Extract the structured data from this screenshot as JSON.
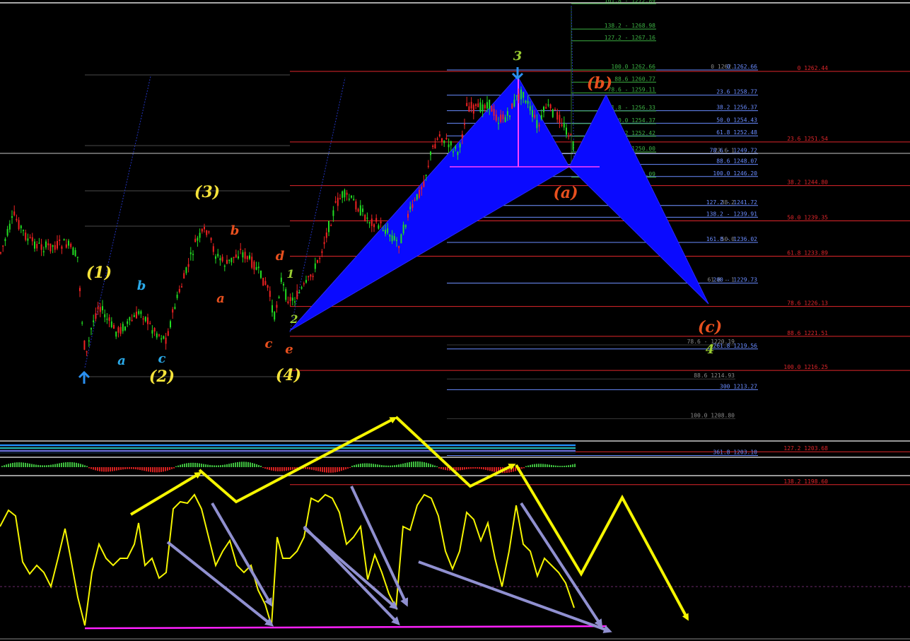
{
  "chart_data": {
    "type": "line",
    "price_axis_labels": [],
    "fib_red": [
      {
        "label": "0 1262.44",
        "price": 1262.44
      },
      {
        "label": "23.6 1251.54",
        "price": 1251.54
      },
      {
        "label": "38.2 1244.80",
        "price": 1244.8
      },
      {
        "label": "50.0 1239.35",
        "price": 1239.35
      },
      {
        "label": "61.8 1233.89",
        "price": 1233.89
      },
      {
        "label": "78.6 1226.13",
        "price": 1226.13
      },
      {
        "label": "88.6 1221.51",
        "price": 1221.51
      },
      {
        "label": "100.0 1216.25",
        "price": 1216.25
      },
      {
        "label": "127.2 1203.68",
        "price": 1203.68
      },
      {
        "label": "138.2 1198.60",
        "price": 1198.6
      }
    ],
    "fib_green": [
      {
        "label": "161.8 - 1272.89",
        "price": 1272.89
      },
      {
        "label": "138.2 - 1268.98",
        "price": 1268.98
      },
      {
        "label": "127.2 - 1267.16",
        "price": 1267.16
      },
      {
        "label": "100.0 1262.66",
        "price": 1262.66
      },
      {
        "label": "88.6 1260.77",
        "price": 1260.77
      },
      {
        "label": "78.6 - 1259.11",
        "price": 1259.11
      },
      {
        "label": "61.8 - 1256.33",
        "price": 1256.33
      },
      {
        "label": "50.0 1254.37",
        "price": 1254.37
      },
      {
        "label": "38.2 1252.42",
        "price": 1252.42
      },
      {
        "label": "23.6 1250.00",
        "price": 1250.0
      },
      {
        "label": "0 1246.09",
        "price": 1246.09
      }
    ],
    "fib_blue": [
      {
        "label": "0 1262.66",
        "price": 1262.66
      },
      {
        "label": "23.6 1258.77",
        "price": 1258.77
      },
      {
        "label": "38.2 1256.37",
        "price": 1256.37
      },
      {
        "label": "50.0 1254.43",
        "price": 1254.43
      },
      {
        "label": "61.8 1252.48",
        "price": 1252.48
      },
      {
        "label": "78.6 - 1249.72",
        "price": 1249.72
      },
      {
        "label": "88.6 1248.07",
        "price": 1248.07
      },
      {
        "label": "100.0 1246.20",
        "price": 1246.2
      },
      {
        "label": "127.2 - 1241.72",
        "price": 1241.72
      },
      {
        "label": "138.2 - 1239.91",
        "price": 1239.91
      },
      {
        "label": "161.8 - 1236.02",
        "price": 1236.02
      },
      {
        "label": "200 - 1229.73",
        "price": 1229.73
      },
      {
        "label": "261.8 1219.56",
        "price": 1219.56
      },
      {
        "label": "300 1213.27",
        "price": 1213.27
      },
      {
        "label": "361.8 1203.10",
        "price": 1203.1
      }
    ],
    "fib_gray": [
      {
        "label": "0 1262.",
        "price": 1262.66
      },
      {
        "label": "23.6 1",
        "price": 1249.72
      },
      {
        "label": "38.2",
        "price": 1241.72
      },
      {
        "label": "50.0",
        "price": 1236.02
      },
      {
        "label": "61.8 - 1",
        "price": 1229.73
      },
      {
        "label": "78.6 - 1220.19",
        "price": 1220.19
      },
      {
        "label": "88.6 1214.93",
        "price": 1214.93
      },
      {
        "label": "100.0 1208.80",
        "price": 1208.8
      }
    ],
    "wave_labels": [
      {
        "text": "(1)",
        "color": "#f5e33a"
      },
      {
        "text": "(2)",
        "color": "#f5e33a"
      },
      {
        "text": "(3)",
        "color": "#f5e33a"
      },
      {
        "text": "(4)",
        "color": "#f5e33a"
      },
      {
        "text": "a",
        "color": "#2aa9e8"
      },
      {
        "text": "b",
        "color": "#2aa9e8"
      },
      {
        "text": "c",
        "color": "#2aa9e8"
      },
      {
        "text": "a",
        "color": "#e8501e"
      },
      {
        "text": "b",
        "color": "#e8501e"
      },
      {
        "text": "c",
        "color": "#e8501e"
      },
      {
        "text": "d",
        "color": "#e8501e"
      },
      {
        "text": "e",
        "color": "#e8501e"
      },
      {
        "text": "1",
        "color": "#9acd32"
      },
      {
        "text": "2",
        "color": "#9acd32"
      },
      {
        "text": "3",
        "color": "#9acd32"
      },
      {
        "text": "4",
        "color": "#9acd32"
      },
      {
        "text": "(a)",
        "color": "#e8501e"
      },
      {
        "text": "(b)",
        "color": "#e8501e"
      },
      {
        "text": "(c)",
        "color": "#e8501e"
      }
    ],
    "colors": {
      "background": "#000000",
      "fib_red": "#e0262b",
      "fib_green": "#3cb043",
      "fib_blue": "#6a8cff",
      "fib_gray": "#8a8a8a",
      "candle_up": "#22dd22",
      "candle_down": "#ee2222",
      "pattern": "#0a0aff",
      "oscillator": "#f5f500",
      "trend_arrows": "#f5f500",
      "divergence": "#9090d0",
      "support": "#ff20ff"
    }
  }
}
